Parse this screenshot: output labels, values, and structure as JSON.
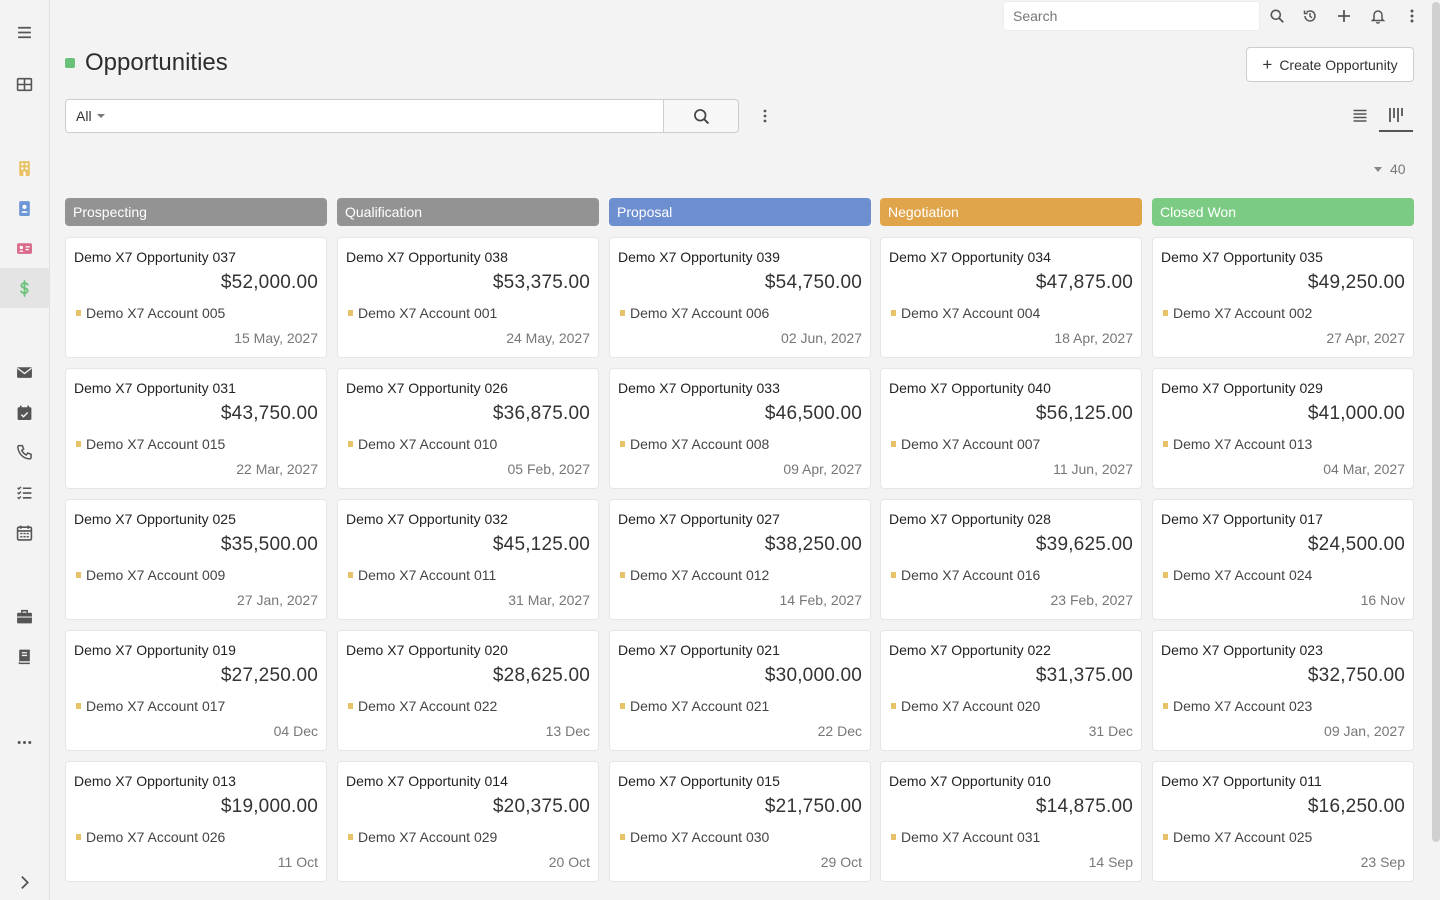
{
  "topbar": {
    "search_placeholder": "Search",
    "icons": [
      "search-icon",
      "history-icon",
      "plus-icon",
      "bell-icon",
      "more-vertical-icon"
    ]
  },
  "sidebar": {
    "items": [
      {
        "name": "menu",
        "icon": "hamburger-icon",
        "color": "#555555"
      },
      {
        "name": "dashboard",
        "icon": "grid-icon",
        "color": "#555555"
      },
      {
        "name": "accounts",
        "icon": "building-icon",
        "color": "#e8c268"
      },
      {
        "name": "contacts",
        "icon": "contact-book-icon",
        "color": "#6d97d6"
      },
      {
        "name": "leads",
        "icon": "id-card-icon",
        "color": "#d96a8a"
      },
      {
        "name": "opportunities",
        "icon": "dollar-icon",
        "color": "#6ac17a",
        "active": true
      },
      {
        "name": "emails",
        "icon": "envelope-icon",
        "color": "#555555"
      },
      {
        "name": "meetings",
        "icon": "calendar-check-icon",
        "color": "#555555"
      },
      {
        "name": "calls",
        "icon": "phone-icon",
        "color": "#555555"
      },
      {
        "name": "tasks",
        "icon": "task-list-icon",
        "color": "#555555"
      },
      {
        "name": "calendar",
        "icon": "calendar-icon",
        "color": "#555555"
      },
      {
        "name": "cases",
        "icon": "briefcase-icon",
        "color": "#555555"
      },
      {
        "name": "knowledge-base",
        "icon": "book-icon",
        "color": "#555555"
      },
      {
        "name": "more",
        "icon": "more-horizontal-icon",
        "color": "#555555"
      },
      {
        "name": "collapse",
        "icon": "chevron-right-icon",
        "color": "#555555"
      }
    ]
  },
  "page": {
    "title": "Opportunities",
    "title_color": "#6ac17a",
    "create_label": "Create Opportunity",
    "filter_label": "All",
    "filter_value": "",
    "total_count": "40"
  },
  "columns": [
    {
      "label": "Prospecting",
      "color": "#939393",
      "cards": [
        {
          "name": "Demo X7 Opportunity 037",
          "amount": "$52,000.00",
          "account": "Demo X7 Account 005",
          "date": "15 May, 2027"
        },
        {
          "name": "Demo X7 Opportunity 031",
          "amount": "$43,750.00",
          "account": "Demo X7 Account 015",
          "date": "22 Mar, 2027"
        },
        {
          "name": "Demo X7 Opportunity 025",
          "amount": "$35,500.00",
          "account": "Demo X7 Account 009",
          "date": "27 Jan, 2027"
        },
        {
          "name": "Demo X7 Opportunity 019",
          "amount": "$27,250.00",
          "account": "Demo X7 Account 017",
          "date": "04 Dec"
        },
        {
          "name": "Demo X7 Opportunity 013",
          "amount": "$19,000.00",
          "account": "Demo X7 Account 026",
          "date": "11 Oct"
        }
      ]
    },
    {
      "label": "Qualification",
      "color": "#939393",
      "cards": [
        {
          "name": "Demo X7 Opportunity 038",
          "amount": "$53,375.00",
          "account": "Demo X7 Account 001",
          "date": "24 May, 2027"
        },
        {
          "name": "Demo X7 Opportunity 026",
          "amount": "$36,875.00",
          "account": "Demo X7 Account 010",
          "date": "05 Feb, 2027"
        },
        {
          "name": "Demo X7 Opportunity 032",
          "amount": "$45,125.00",
          "account": "Demo X7 Account 011",
          "date": "31 Mar, 2027"
        },
        {
          "name": "Demo X7 Opportunity 020",
          "amount": "$28,625.00",
          "account": "Demo X7 Account 022",
          "date": "13 Dec"
        },
        {
          "name": "Demo X7 Opportunity 014",
          "amount": "$20,375.00",
          "account": "Demo X7 Account 029",
          "date": "20 Oct"
        }
      ]
    },
    {
      "label": "Proposal",
      "color": "#6d8fcf",
      "cards": [
        {
          "name": "Demo X7 Opportunity 039",
          "amount": "$54,750.00",
          "account": "Demo X7 Account 006",
          "date": "02 Jun, 2027"
        },
        {
          "name": "Demo X7 Opportunity 033",
          "amount": "$46,500.00",
          "account": "Demo X7 Account 008",
          "date": "09 Apr, 2027"
        },
        {
          "name": "Demo X7 Opportunity 027",
          "amount": "$38,250.00",
          "account": "Demo X7 Account 012",
          "date": "14 Feb, 2027"
        },
        {
          "name": "Demo X7 Opportunity 021",
          "amount": "$30,000.00",
          "account": "Demo X7 Account 021",
          "date": "22 Dec"
        },
        {
          "name": "Demo X7 Opportunity 015",
          "amount": "$21,750.00",
          "account": "Demo X7 Account 030",
          "date": "29 Oct"
        }
      ]
    },
    {
      "label": "Negotiation",
      "color": "#e0a54b",
      "cards": [
        {
          "name": "Demo X7 Opportunity 034",
          "amount": "$47,875.00",
          "account": "Demo X7 Account 004",
          "date": "18 Apr, 2027"
        },
        {
          "name": "Demo X7 Opportunity 040",
          "amount": "$56,125.00",
          "account": "Demo X7 Account 007",
          "date": "11 Jun, 2027"
        },
        {
          "name": "Demo X7 Opportunity 028",
          "amount": "$39,625.00",
          "account": "Demo X7 Account 016",
          "date": "23 Feb, 2027"
        },
        {
          "name": "Demo X7 Opportunity 022",
          "amount": "$31,375.00",
          "account": "Demo X7 Account 020",
          "date": "31 Dec"
        },
        {
          "name": "Demo X7 Opportunity 010",
          "amount": "$14,875.00",
          "account": "Demo X7 Account 031",
          "date": "14 Sep"
        }
      ]
    },
    {
      "label": "Closed Won",
      "color": "#7ccb84",
      "cards": [
        {
          "name": "Demo X7 Opportunity 035",
          "amount": "$49,250.00",
          "account": "Demo X7 Account 002",
          "date": "27 Apr, 2027"
        },
        {
          "name": "Demo X7 Opportunity 029",
          "amount": "$41,000.00",
          "account": "Demo X7 Account 013",
          "date": "04 Mar, 2027"
        },
        {
          "name": "Demo X7 Opportunity 017",
          "amount": "$24,500.00",
          "account": "Demo X7 Account 024",
          "date": "16 Nov"
        },
        {
          "name": "Demo X7 Opportunity 023",
          "amount": "$32,750.00",
          "account": "Demo X7 Account 023",
          "date": "09 Jan, 2027"
        },
        {
          "name": "Demo X7 Opportunity 011",
          "amount": "$16,250.00",
          "account": "Demo X7 Account 025",
          "date": "23 Sep"
        }
      ]
    }
  ]
}
